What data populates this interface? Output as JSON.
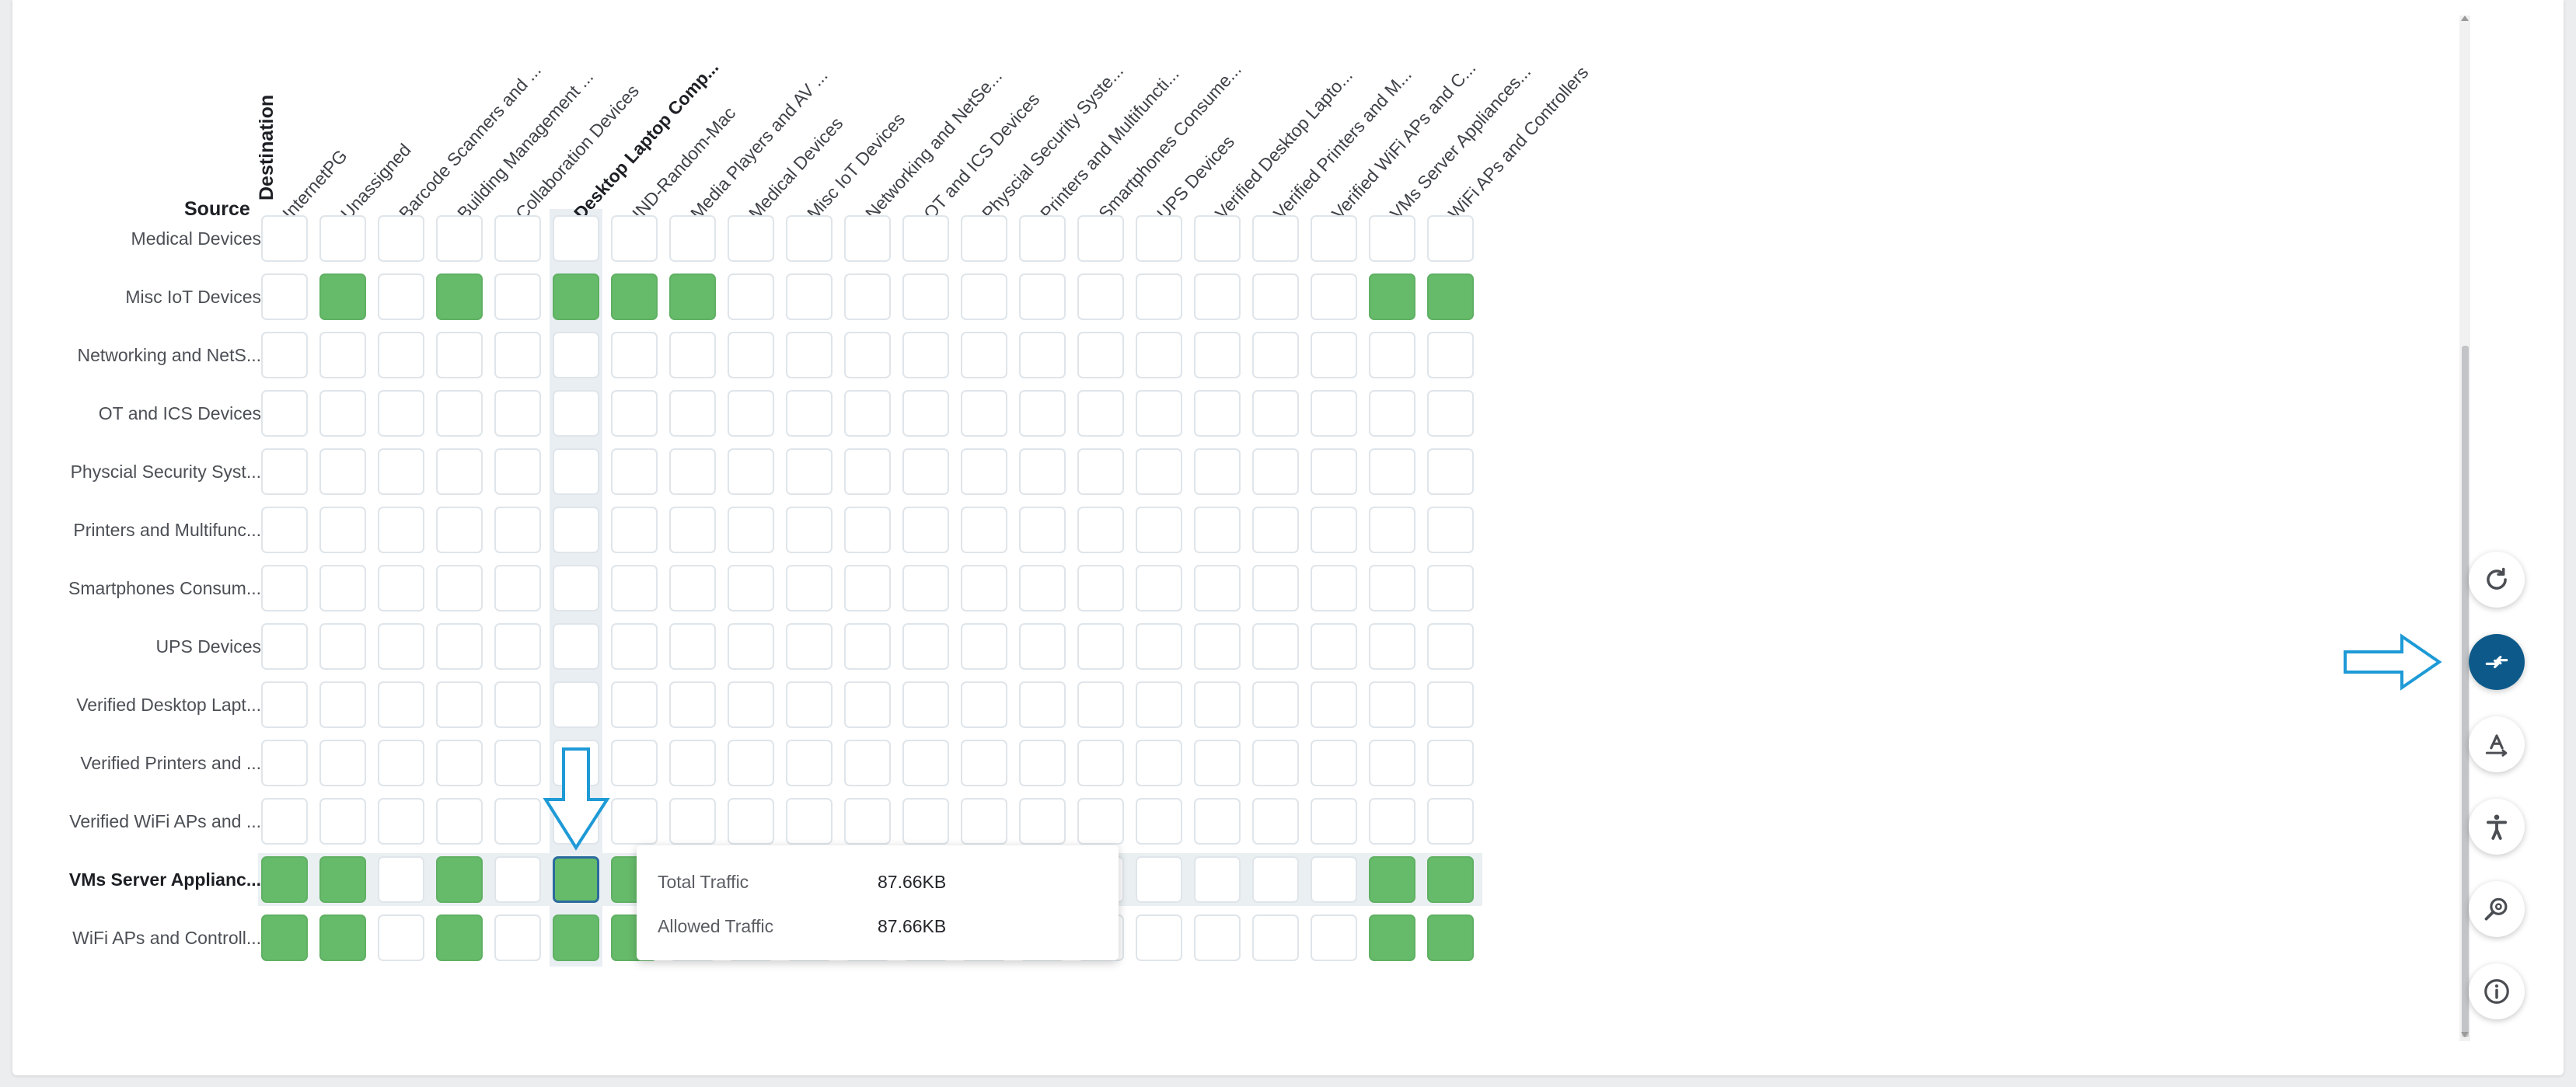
{
  "axes": {
    "source_title": "Source",
    "destination_title": "Destination"
  },
  "columns": [
    "InternetPG",
    "Unassigned",
    "Barcode Scanners and ...",
    "Building Management ...",
    "Collaboration Devices",
    "Desktop Laptop Comp...",
    "IND-Random-Mac",
    "Media Players and AV ...",
    "Medical Devices",
    "Misc IoT Devices",
    "Networking and NetSe...",
    "OT and ICS Devices",
    "Physcial Security Syste...",
    "Printers and Multifuncti...",
    "Smartphones Consume...",
    "UPS Devices",
    "Verified Desktop Lapto...",
    "Verified Printers and M...",
    "Verified WiFi APs and C...",
    "VMs Server Appliances...",
    "WiFi APs and Controllers"
  ],
  "rows": [
    {
      "label": "Medical Devices",
      "cells": []
    },
    {
      "label": "Misc IoT Devices",
      "cells": [
        1,
        3,
        5,
        6,
        7,
        19,
        20
      ]
    },
    {
      "label": "Networking and NetS...",
      "cells": []
    },
    {
      "label": "OT and ICS Devices",
      "cells": []
    },
    {
      "label": "Physcial Security Syst...",
      "cells": []
    },
    {
      "label": "Printers and Multifunc...",
      "cells": []
    },
    {
      "label": "Smartphones Consum...",
      "cells": []
    },
    {
      "label": "UPS Devices",
      "cells": []
    },
    {
      "label": "Verified Desktop Lapt...",
      "cells": []
    },
    {
      "label": "Verified Printers and ...",
      "cells": []
    },
    {
      "label": "Verified WiFi APs and ...",
      "cells": []
    },
    {
      "label": "VMs Server Applianc...",
      "cells": [
        0,
        1,
        3,
        5,
        6,
        19,
        20
      ]
    },
    {
      "label": "WiFi APs and Controll...",
      "cells": [
        0,
        1,
        3,
        5,
        6,
        19,
        20
      ]
    }
  ],
  "selected_column": 5,
  "selected_row": 11,
  "tooltip": {
    "total_label": "Total Traffic",
    "total_value": "87.66KB",
    "allowed_label": "Allowed Traffic",
    "allowed_value": "87.66KB"
  },
  "toolbar": {
    "buttons": [
      {
        "name": "refresh",
        "active": false
      },
      {
        "name": "swap-axes",
        "active": true
      },
      {
        "name": "text-orientation",
        "active": false
      },
      {
        "name": "accessibility",
        "active": false
      },
      {
        "name": "search-settings",
        "active": false
      },
      {
        "name": "info",
        "active": false
      }
    ]
  },
  "colors": {
    "allowed": "#66bb6a",
    "active_button": "#0d5a8a",
    "callout_arrow": "#1e9ad6"
  }
}
